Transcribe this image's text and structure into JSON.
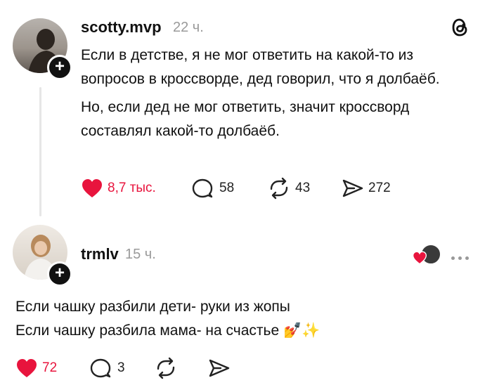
{
  "post1": {
    "username": "scotty.mvp",
    "time": "22 ч.",
    "paragraphs": [
      "Если в детстве, я не мог ответить на какой-то из вопросов в кроссворде, дед говорил, что я долбаёб.",
      "Но, если дед не мог ответить, значит кроссворд составлял какой-то долбаёб."
    ],
    "likes": "8,7 тыс.",
    "comments": "58",
    "reposts": "43",
    "shares": "272"
  },
  "post2": {
    "username": "trmlv",
    "time": "15 ч.",
    "lines": [
      "Если чашку разбили дети- руки из жопы",
      "Если чашку разбила мама- на счастье 💅✨"
    ],
    "likes": "72",
    "comments": "3"
  },
  "colors": {
    "like": "#e8143d",
    "text": "#111111",
    "muted": "#9a9a9a"
  },
  "icons": [
    "threads-logo-icon",
    "heart-icon",
    "comment-icon",
    "repost-icon",
    "share-icon",
    "more-icon"
  ]
}
